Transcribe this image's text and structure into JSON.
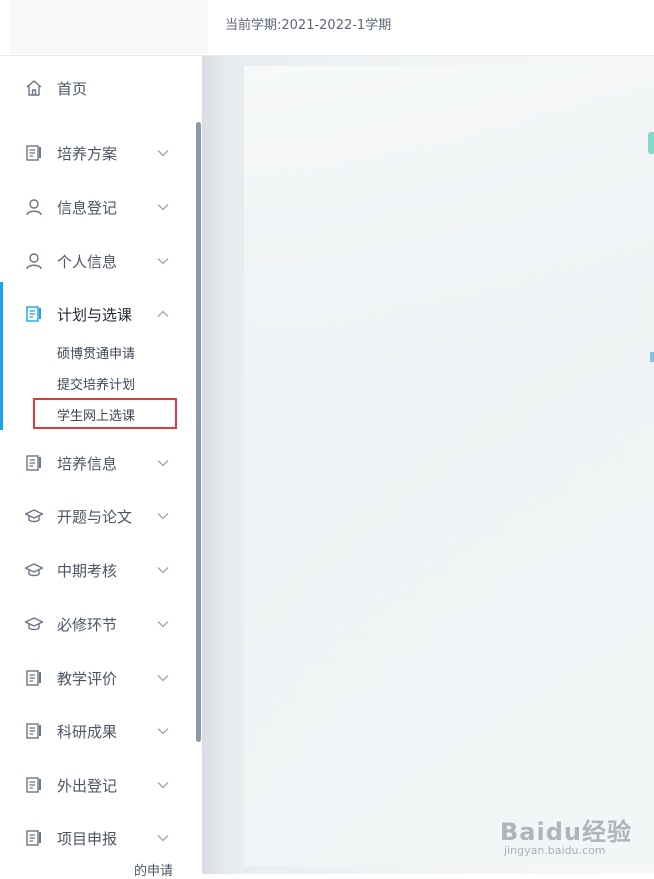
{
  "header": {
    "semester_label": "当前学期:2021-2022-1学期"
  },
  "sidebar": {
    "items": [
      {
        "name": "home",
        "label": "首页",
        "icon": "home-icon",
        "chevron": ""
      },
      {
        "name": "training-plan",
        "label": "培养方案",
        "icon": "document-icon",
        "chevron": "chevron-down-icon"
      },
      {
        "name": "info-register",
        "label": "信息登记",
        "icon": "user-icon",
        "chevron": "chevron-down-icon"
      },
      {
        "name": "personal-info",
        "label": "个人信息",
        "icon": "user-icon",
        "chevron": "chevron-down-icon"
      },
      {
        "name": "plan-course",
        "label": "计划与选课",
        "icon": "document-icon",
        "chevron": "chevron-up-icon"
      },
      {
        "name": "training-info",
        "label": "培养信息",
        "icon": "document-icon",
        "chevron": "chevron-down-icon"
      },
      {
        "name": "proposal-thesis",
        "label": "开题与论文",
        "icon": "graduation-cap-icon",
        "chevron": "chevron-down-icon"
      },
      {
        "name": "midterm-review",
        "label": "中期考核",
        "icon": "graduation-cap-icon",
        "chevron": "chevron-down-icon"
      },
      {
        "name": "required-steps",
        "label": "必修环节",
        "icon": "graduation-cap-icon",
        "chevron": "chevron-down-icon"
      },
      {
        "name": "teaching-eval",
        "label": "教学评价",
        "icon": "document-icon",
        "chevron": "chevron-down-icon"
      },
      {
        "name": "research-results",
        "label": "科研成果",
        "icon": "document-icon",
        "chevron": "chevron-down-icon"
      },
      {
        "name": "outing-register",
        "label": "外出登记",
        "icon": "document-icon",
        "chevron": "chevron-down-icon"
      },
      {
        "name": "project-apply",
        "label": "项目申报",
        "icon": "document-icon",
        "chevron": "chevron-down-icon"
      }
    ],
    "sub_items": [
      {
        "label": "硕博贯通申请"
      },
      {
        "label": "提交培养计划"
      },
      {
        "label": "学生网上选课"
      }
    ],
    "bottom_fragment": "的申请"
  },
  "watermark": {
    "brand": "Baidu经验",
    "site": "jingyan.baidu.com"
  },
  "colors": {
    "accent": "#1aa3e8",
    "highlight": "#e0393e",
    "text": "#4b5566"
  }
}
